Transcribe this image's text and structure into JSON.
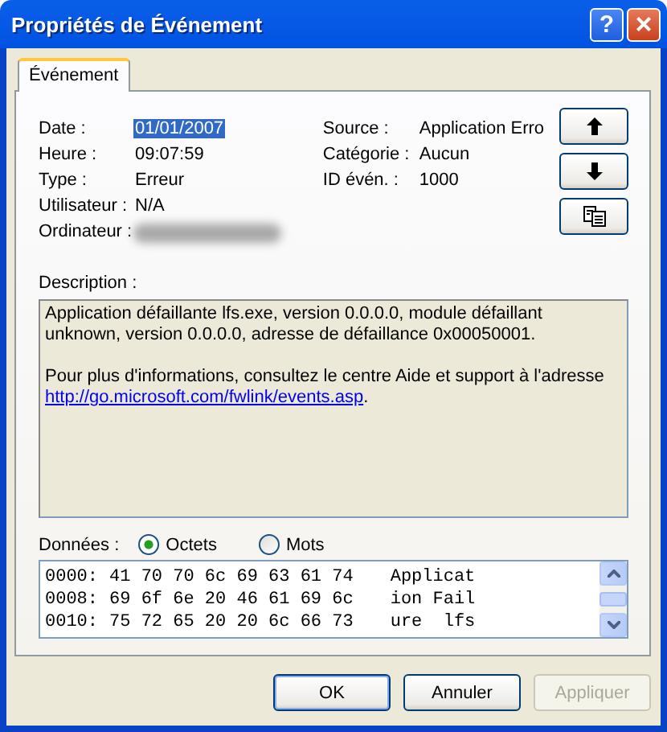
{
  "window": {
    "title": "Propriétés de Événement",
    "controls": [
      {
        "kind": "help",
        "label": "?"
      },
      {
        "kind": "close",
        "label": "×"
      }
    ]
  },
  "tabs": [
    {
      "label": "Événement",
      "selected": true
    }
  ],
  "fields_left": [
    {
      "label": "Date :",
      "value": "01/01/2007",
      "selected": true
    },
    {
      "label": "Heure :",
      "value": "09:07:59",
      "selected": false
    },
    {
      "label": "Type :",
      "value": "Erreur",
      "selected": false
    },
    {
      "label": "Utilisateur :",
      "value": "N/A",
      "selected": false
    },
    {
      "label": "Ordinateur :",
      "redacted": true,
      "selected": false
    }
  ],
  "fields_right": [
    {
      "label": "Source :",
      "value": "Application Erro"
    },
    {
      "label": "Catégorie :",
      "value": "Aucun"
    },
    {
      "label": "ID évén. :",
      "value": "1000"
    }
  ],
  "side_buttons": [
    {
      "kind": "up"
    },
    {
      "kind": "down"
    },
    {
      "kind": "copy"
    }
  ],
  "description": {
    "label": "Description :",
    "paragraphs": [
      "Application défaillante lfs.exe, version 0.0.0.0, module défaillant unknown, version 0.0.0.0, adresse de défaillance 0x00050001."
    ],
    "help_text": "Pour plus d'informations, consultez le centre Aide et support à l'adresse",
    "link": "http://go.microsoft.com/fwlink/events.asp",
    "after_link": "."
  },
  "data": {
    "label": "Données :",
    "options": [
      {
        "label": "Octets",
        "selected": true
      },
      {
        "label": "Mots",
        "selected": false
      }
    ],
    "rows": [
      {
        "offset": "0000:",
        "hex": "41 70 70 6c 69 63 61 74",
        "text": "Applicat"
      },
      {
        "offset": "0008:",
        "hex": "69 6f 6e 20 46 61 69 6c",
        "text": "ion Fail"
      },
      {
        "offset": "0010:",
        "hex": "75 72 65 20 20 6c 66 73",
        "text": "ure  lfs"
      }
    ]
  },
  "buttons": [
    {
      "label": "OK",
      "disabled": false,
      "default": true
    },
    {
      "label": "Annuler",
      "disabled": false,
      "default": false
    },
    {
      "label": "Appliquer",
      "disabled": true,
      "default": false
    }
  ]
}
